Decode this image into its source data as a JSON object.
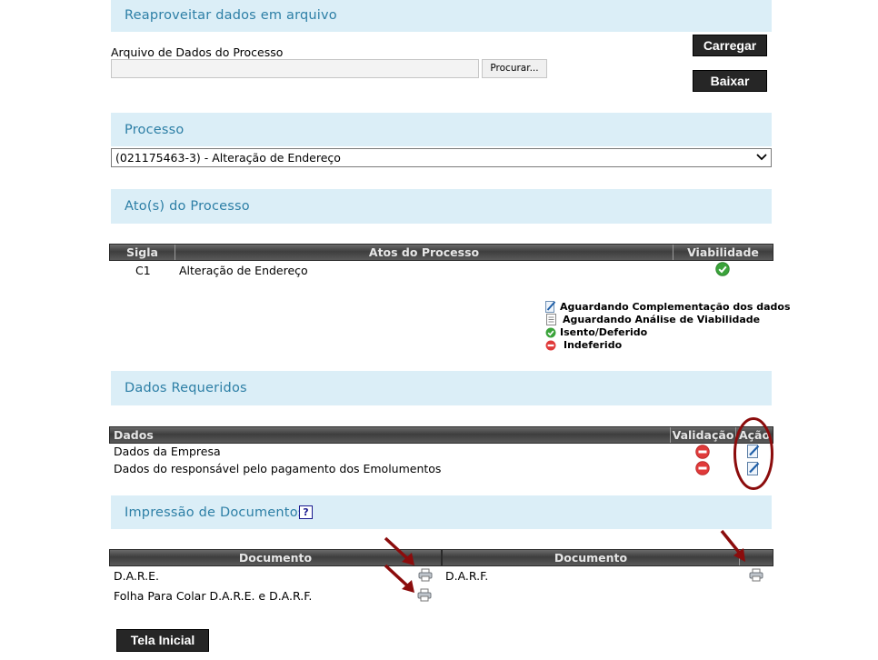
{
  "reaproveitar": {
    "title": "Reaproveitar dados em arquivo",
    "file_label": "Arquivo de Dados do Processo",
    "file_value": "",
    "browse_label": "Procurar...",
    "load_button": "Carregar",
    "download_button": "Baixar"
  },
  "processo": {
    "title": "Processo",
    "selected": "(021175463-3) - Alteração de Endereço"
  },
  "atos": {
    "title": "Ato(s) do Processo",
    "headers": [
      "Sigla",
      "Atos do Processo",
      "Viabilidade"
    ],
    "rows": [
      {
        "sigla": "C1",
        "ato": "Alteração de Endereço",
        "viabilidade_icon": "check-green-icon"
      }
    ],
    "legend": [
      {
        "icon": "edit-icon",
        "label": "Aguardando Complementação dos dados"
      },
      {
        "icon": "document-icon",
        "label": "Aguardando Análise de Viabilidade"
      },
      {
        "icon": "check-green-icon",
        "label": "Isento/Deferido"
      },
      {
        "icon": "minus-red-icon",
        "label": "Indeferido"
      }
    ]
  },
  "dados": {
    "title": "Dados Requeridos",
    "headers": [
      "Dados",
      "Validação",
      "Ação"
    ],
    "rows": [
      {
        "label": "Dados da Empresa",
        "validacao_icon": "minus-red-icon",
        "acao_icon": "edit-icon"
      },
      {
        "label": "Dados do responsável pelo pagamento dos Emolumentos",
        "validacao_icon": "minus-red-icon",
        "acao_icon": "edit-icon"
      }
    ]
  },
  "impressao": {
    "title": "Impressão de Documentos",
    "help_icon": "help-icon",
    "headers": [
      "Documento",
      "Documento"
    ],
    "left_docs": [
      "D.A.R.E.",
      "Folha Para Colar D.A.R.E. e D.A.R.F."
    ],
    "right_docs": [
      "D.A.R.F."
    ],
    "print_icon": "printer-icon"
  },
  "footer": {
    "home_button": "Tela Inicial"
  },
  "colors": {
    "band_bg": "#dbeef7",
    "band_title": "#2d7fa6",
    "annotation": "#8b0c0c",
    "success": "#3aa33a",
    "error": "#e03a3a"
  }
}
